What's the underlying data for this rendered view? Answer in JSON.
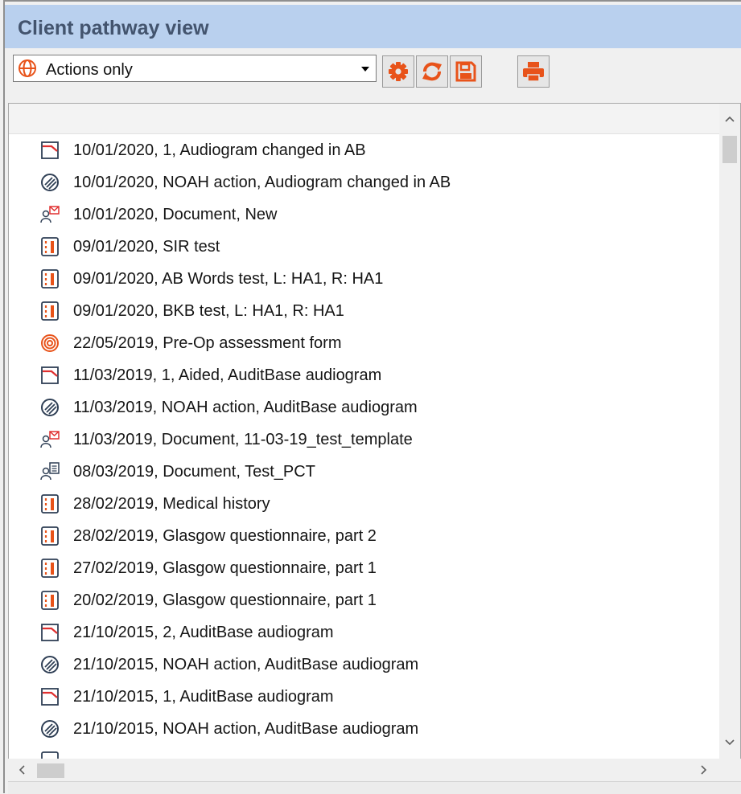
{
  "panel": {
    "title": "Client pathway view"
  },
  "toolbar": {
    "filter_selected": "Actions only",
    "filter_icon": "globe-icon",
    "buttons": [
      {
        "name": "settings-button",
        "icon": "gear-icon"
      },
      {
        "name": "refresh-button",
        "icon": "refresh-icon"
      },
      {
        "name": "save-button",
        "icon": "save-icon"
      },
      {
        "name": "print-button",
        "icon": "print-icon"
      }
    ]
  },
  "colors": {
    "accent": "#e8531a",
    "title_bg": "#b9d0ee",
    "title_text": "#43546e"
  },
  "pathway": {
    "items": [
      {
        "icon": "audiogram-icon",
        "text": "10/01/2020, 1, Audiogram changed in AB"
      },
      {
        "icon": "noah-icon",
        "text": "10/01/2020, NOAH action, Audiogram changed in AB"
      },
      {
        "icon": "document-icon",
        "text": "10/01/2020, Document, New"
      },
      {
        "icon": "test-icon",
        "text": "09/01/2020, SIR test"
      },
      {
        "icon": "test-icon",
        "text": "09/01/2020, AB Words test, L: HA1, R: HA1"
      },
      {
        "icon": "test-icon",
        "text": "09/01/2020, BKB test, L: HA1, R: HA1"
      },
      {
        "icon": "spiral-icon",
        "text": "22/05/2019, Pre-Op assessment form"
      },
      {
        "icon": "audiogram-icon",
        "text": "11/03/2019, 1, Aided, AuditBase audiogram"
      },
      {
        "icon": "noah-icon",
        "text": "11/03/2019, NOAH action, AuditBase audiogram"
      },
      {
        "icon": "document-icon",
        "text": "11/03/2019, Document, 11-03-19_test_template"
      },
      {
        "icon": "document-list-icon",
        "text": "08/03/2019, Document, Test_PCT"
      },
      {
        "icon": "test-icon",
        "text": "28/02/2019, Medical history"
      },
      {
        "icon": "test-icon",
        "text": "28/02/2019, Glasgow questionnaire, part 2"
      },
      {
        "icon": "test-icon",
        "text": "27/02/2019, Glasgow questionnaire, part 1"
      },
      {
        "icon": "test-icon",
        "text": "20/02/2019, Glasgow questionnaire, part 1"
      },
      {
        "icon": "audiogram-icon",
        "text": "21/10/2015, 2, AuditBase audiogram"
      },
      {
        "icon": "noah-icon",
        "text": "21/10/2015, NOAH action, AuditBase audiogram"
      },
      {
        "icon": "audiogram-icon",
        "text": "21/10/2015, 1, AuditBase audiogram"
      },
      {
        "icon": "noah-icon",
        "text": "21/10/2015, NOAH action, AuditBase audiogram"
      }
    ]
  }
}
